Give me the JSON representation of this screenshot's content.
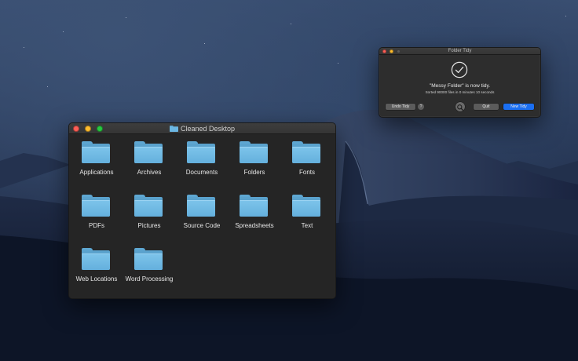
{
  "finder": {
    "title": "Cleaned Desktop",
    "folders": [
      "Applications",
      "Archives",
      "Documents",
      "Folders",
      "Fonts",
      "PDFs",
      "Pictures",
      "Source Code",
      "Spreadsheets",
      "Text",
      "Web Locations",
      "Word Processing"
    ]
  },
  "tidy": {
    "title": "Folder Tidy",
    "message": "\"Messy Folder\" is now tidy.",
    "subtext": "Sorted 90000 files in 0 minutes 10 seconds",
    "undo_label": "Undo Tidy",
    "help_label": "?",
    "quit_label": "Quit",
    "new_tidy_label": "New Tidy"
  },
  "icons": {
    "folder": "folder-icon",
    "check": "checkmark-circle-icon",
    "search": "magnifier-icon"
  },
  "colors": {
    "folder_blue": "#6bb6e2",
    "primary_button": "#1b6ff2",
    "close": "#fe5f57",
    "minimize": "#febc2e",
    "zoom": "#28c840"
  }
}
